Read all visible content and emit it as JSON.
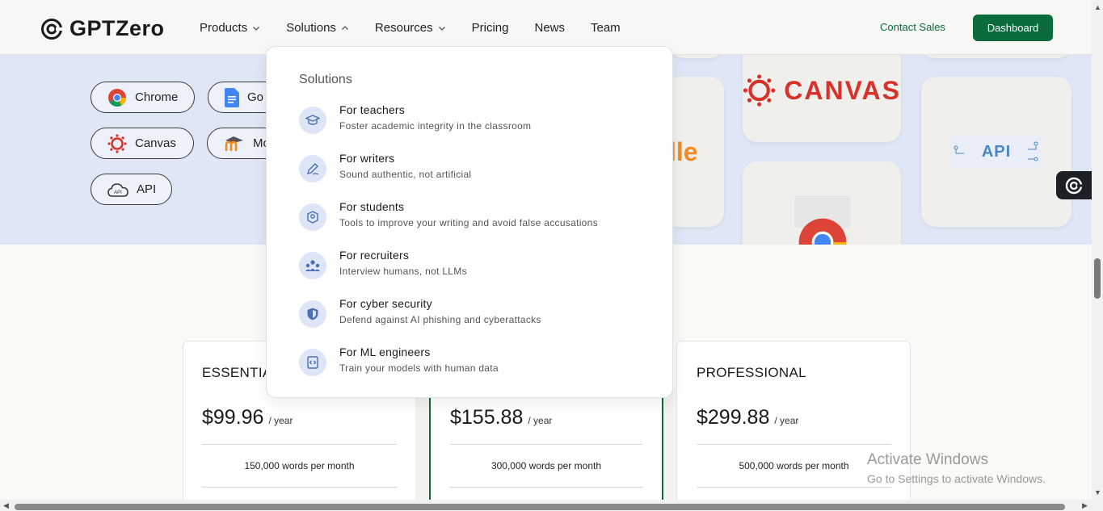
{
  "brand": {
    "name": "GPTZero"
  },
  "nav": {
    "items": [
      {
        "label": "Products",
        "has_chevron": true,
        "chevron": "down"
      },
      {
        "label": "Solutions",
        "has_chevron": true,
        "chevron": "up"
      },
      {
        "label": "Resources",
        "has_chevron": true,
        "chevron": "down"
      },
      {
        "label": "Pricing",
        "has_chevron": false
      },
      {
        "label": "News",
        "has_chevron": false
      },
      {
        "label": "Team",
        "has_chevron": false
      }
    ],
    "contact_label": "Contact Sales",
    "dashboard_label": "Dashboard"
  },
  "hero": {
    "integrations": [
      {
        "label": "Chrome",
        "icon": "chrome-icon"
      },
      {
        "label": "Go",
        "icon": "google-docs-icon"
      },
      {
        "label": "Canvas",
        "icon": "canvas-icon"
      },
      {
        "label": "Mo",
        "icon": "moodle-icon"
      },
      {
        "label": "API",
        "icon": "cloud-api-icon"
      }
    ],
    "tiles": {
      "canvas": "CANVAS",
      "moodle_fragment": "lle",
      "api": "API"
    }
  },
  "dropdown": {
    "title": "Solutions",
    "items": [
      {
        "label": "For teachers",
        "desc": "Foster academic integrity in the classroom",
        "icon": "graduation-cap-icon"
      },
      {
        "label": "For writers",
        "desc": "Sound authentic, not artificial",
        "icon": "pen-icon"
      },
      {
        "label": "For students",
        "desc": "Tools to improve your writing and avoid false accusations",
        "icon": "student-icon"
      },
      {
        "label": "For recruiters",
        "desc": "Interview humans, not LLMs",
        "icon": "people-icon"
      },
      {
        "label": "For cyber security",
        "desc": "Defend against AI phishing and cyberattacks",
        "icon": "shield-icon"
      },
      {
        "label": "For ML engineers",
        "desc": "Train your models with human data",
        "icon": "code-icon"
      }
    ]
  },
  "pricing": {
    "cards": [
      {
        "title": "ESSENTIA",
        "price": "$99.96",
        "period": "/ year",
        "words": "150,000 words per month"
      },
      {
        "title": "",
        "price": "$155.88",
        "period": "/ year",
        "words": "300,000 words per month"
      },
      {
        "title": "PROFESSIONAL",
        "price": "$299.88",
        "period": "/ year",
        "words": "500,000 words per month"
      }
    ]
  },
  "watermark": {
    "line1": "Activate Windows",
    "line2": "Go to Settings to activate Windows."
  },
  "colors": {
    "brand_green": "#0b6b3a",
    "hero_bg": "#dfe6f5",
    "icon_bg": "#dde5f6",
    "canvas_red": "#d6312a",
    "moodle_orange": "#f28a1e"
  }
}
